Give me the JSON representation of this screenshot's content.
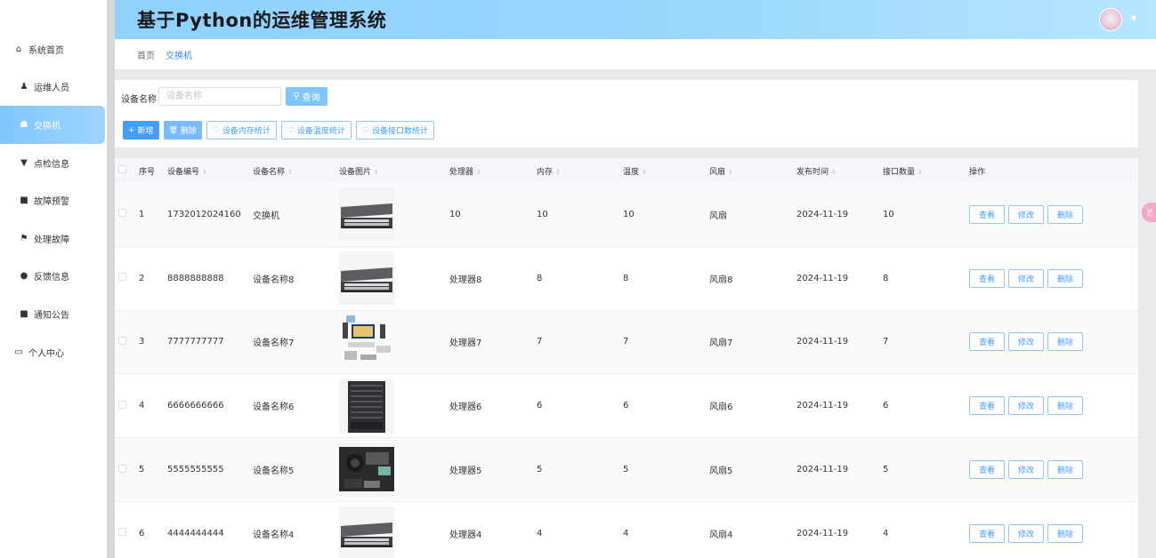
{
  "header": {
    "title": "基于Python的运维管理系统",
    "caret": "▼"
  },
  "sidebar": {
    "items": [
      {
        "icon": "⌂",
        "label": "系统首页"
      },
      {
        "icon": "♟",
        "label": "运维人员"
      },
      {
        "icon": "☗",
        "label": "交换机"
      },
      {
        "icon": "▼",
        "label": "点检信息"
      },
      {
        "icon": "■",
        "label": "故障预警"
      },
      {
        "icon": "⚑",
        "label": "处理故障"
      },
      {
        "icon": "●",
        "label": "反馈信息"
      },
      {
        "icon": "■",
        "label": "通知公告"
      },
      {
        "icon": "▭",
        "label": "个人中心"
      }
    ]
  },
  "breadcrumb": [
    "首页",
    "交换机"
  ],
  "search": {
    "label": "设备名称",
    "placeholder": "设备名称",
    "value": "",
    "button": "查询",
    "button_icon": "⚲"
  },
  "toolbar": {
    "add": "新增",
    "add_icon": "+",
    "delete": "删除",
    "delete_icon": "🗑",
    "mem_stats": "设备内存统计",
    "temp_stats": "设备温度统计",
    "port_stats": "设备接口数统计",
    "stat_icon": "♡"
  },
  "table": {
    "columns": {
      "index": "序号",
      "code": "设备编号",
      "name": "设备名称",
      "image": "设备图片",
      "cpu": "处理器",
      "memory": "内存",
      "temperature": "温度",
      "fan": "风扇",
      "date": "发布时间",
      "ports": "接口数量",
      "ops": "操作"
    },
    "sort_icon": "⇕",
    "actions": {
      "view": "查看",
      "edit": "修改",
      "delete": "删除"
    },
    "rows": [
      {
        "index": "1",
        "code": "1732012024160",
        "name": "交换机",
        "image": "switch",
        "cpu": "10",
        "memory": "10",
        "temperature": "10",
        "fan": "风扇",
        "date": "2024-11-19",
        "ports": "10"
      },
      {
        "index": "2",
        "code": "8888888888",
        "name": "设备名称8",
        "image": "switch",
        "cpu": "处理器8",
        "memory": "8",
        "temperature": "8",
        "fan": "风扇8",
        "date": "2024-11-19",
        "ports": "8"
      },
      {
        "index": "3",
        "code": "7777777777",
        "name": "设备名称7",
        "image": "desk",
        "cpu": "处理器7",
        "memory": "7",
        "temperature": "7",
        "fan": "风扇7",
        "date": "2024-11-19",
        "ports": "7"
      },
      {
        "index": "4",
        "code": "6666666666",
        "name": "设备名称6",
        "image": "chassis",
        "cpu": "处理器6",
        "memory": "6",
        "temperature": "6",
        "fan": "风扇6",
        "date": "2024-11-19",
        "ports": "6"
      },
      {
        "index": "5",
        "code": "5555555555",
        "name": "设备名称5",
        "image": "camera",
        "cpu": "处理器5",
        "memory": "5",
        "temperature": "5",
        "fan": "风扇5",
        "date": "2024-11-19",
        "ports": "5"
      },
      {
        "index": "6",
        "code": "4444444444",
        "name": "设备名称4",
        "image": "switch",
        "cpu": "处理器4",
        "memory": "4",
        "temperature": "4",
        "fan": "风扇4",
        "date": "2024-11-19",
        "ports": "4"
      }
    ]
  },
  "side_tab": {
    "label": "艺"
  },
  "colors": {
    "accent": "#409eff",
    "header_gradient": "#8fd1ff",
    "active_menu": "#7fc6ff"
  }
}
